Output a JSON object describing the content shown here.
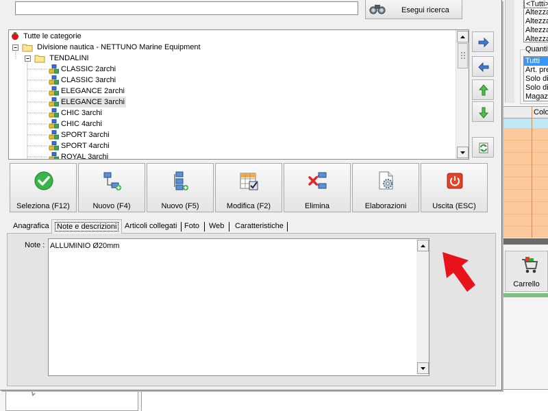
{
  "background_window": {
    "filter_list_1": [
      "<Tutti>",
      "Altezza",
      "Altezza",
      "Altezza",
      "Altezza"
    ],
    "quantity_frame_label": "Quantit",
    "quantity_list": [
      "Tutti",
      "Art. pre",
      "Solo dis",
      "Solo dis",
      "Magazz"
    ],
    "grid_header": "Colo",
    "cart_label": "Carrello"
  },
  "search": {
    "value": "",
    "button_label": "Esegui ricerca"
  },
  "tree": {
    "root": "Tutte le categorie",
    "division": "Divisione nautica - NETTUNO Marine Equipment",
    "folder": "TENDALINI",
    "items": [
      "CLASSIC 2archi",
      "CLASSIC 3archi",
      "ELEGANCE 2archi",
      "ELEGANCE 3archi",
      "CHIC 3archi",
      "CHIC 4archi",
      "SPORT 3archi",
      "SPORT 4archi",
      "ROYAL 3archi"
    ],
    "selected_item": "ELEGANCE 3archi"
  },
  "toolbar": {
    "select": "Seleziona (F12)",
    "new_f4": "Nuovo (F4)",
    "new_f5": "Nuovo (F5)",
    "edit": "Modifica (F2)",
    "delete": "Elimina",
    "processing": "Elaborazioni",
    "exit": "Uscita (ESC)"
  },
  "tabs": {
    "anagrafica": "Anagrafica",
    "notes": "Note e descrizioni",
    "linked": "Articoli collegati",
    "photo": "Foto",
    "web": "Web",
    "features": "Caratteristiche",
    "active": "Note e descrizioni"
  },
  "notes": {
    "label": "Note :",
    "value": "ALLUMINIO Ø20mm"
  },
  "colors": {
    "accent_selection": "#3399ff",
    "grid_orange": "#fbc99b",
    "annotation_arrow": "#e8131a"
  }
}
